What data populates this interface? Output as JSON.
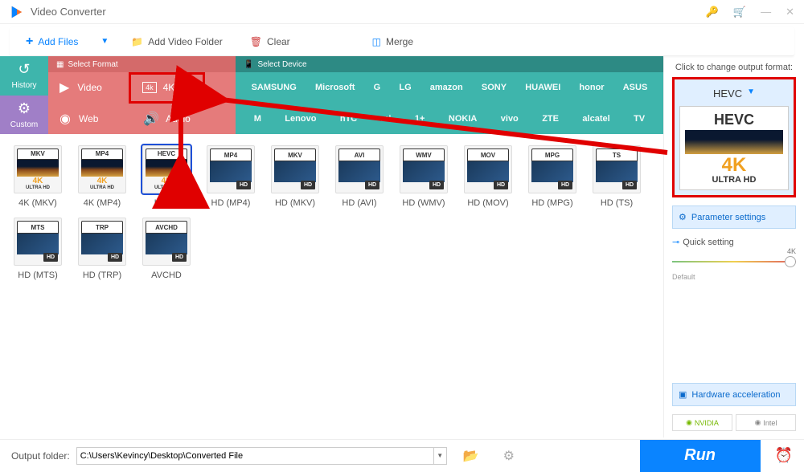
{
  "title": "Video Converter",
  "toolbar": {
    "add_files": "Add Files",
    "add_folder": "Add Video Folder",
    "clear": "Clear",
    "merge": "Merge"
  },
  "side_tabs": {
    "history": "History",
    "custom": "Custom"
  },
  "fmt_tabs": {
    "format": "Select Format",
    "device": "Select Device"
  },
  "fmt_left": {
    "video": "Video",
    "fourk": "4K/HD",
    "web": "Web",
    "audio": "Audio"
  },
  "brands_row1": [
    "SAMSUNG",
    "Microsoft",
    "G",
    "LG",
    "amazon",
    "SONY",
    "HUAWEI",
    "honor",
    "ASUS"
  ],
  "brands_row2": [
    "M",
    "Lenovo",
    "hTC",
    "mi",
    "1+",
    "NOKIA",
    "vivo",
    "ZTE",
    "alcatel",
    "TV"
  ],
  "tiles": [
    {
      "top": "MKV",
      "bot": "ULTRA HD",
      "mode": "u",
      "label": "4K (MKV)"
    },
    {
      "top": "MP4",
      "bot": "ULTRA HD",
      "mode": "u",
      "label": "4K (MP4)"
    },
    {
      "top": "HEVC",
      "bot": "ULTRA HD",
      "mode": "u",
      "label": "HEVC",
      "sel": true
    },
    {
      "top": "MP4",
      "bot": "HD",
      "mode": "hd",
      "label": "HD (MP4)"
    },
    {
      "top": "MKV",
      "bot": "HD",
      "mode": "hd",
      "label": "HD (MKV)"
    },
    {
      "top": "AVI",
      "bot": "HD",
      "mode": "hd",
      "label": "HD (AVI)"
    },
    {
      "top": "WMV",
      "bot": "HD",
      "mode": "hd",
      "label": "HD (WMV)"
    },
    {
      "top": "MOV",
      "bot": "HD",
      "mode": "hd",
      "label": "HD (MOV)"
    },
    {
      "top": "MPG",
      "bot": "HD",
      "mode": "hd",
      "label": "HD (MPG)"
    },
    {
      "top": "TS",
      "bot": "HD",
      "mode": "hd",
      "label": "HD (TS)"
    },
    {
      "top": "MTS",
      "bot": "HD",
      "mode": "hd",
      "label": "HD (MTS)"
    },
    {
      "top": "TRP",
      "bot": "HD",
      "mode": "hd",
      "label": "HD (TRP)"
    },
    {
      "top": "AVCHD",
      "bot": "HD",
      "mode": "hd",
      "label": "AVCHD"
    }
  ],
  "right": {
    "title": "Click to change output format:",
    "selected": "HEVC",
    "hevc": "HEVC",
    "fourk": "4K",
    "uhd": "ULTRA HD",
    "param": "Parameter settings",
    "quick": "Quick setting",
    "quality_max": "4K",
    "default": "Default",
    "hw": "Hardware acceleration",
    "nvidia": "NVIDIA",
    "intel": "Intel"
  },
  "bottom": {
    "label": "Output folder:",
    "path": "C:\\Users\\Kevincy\\Desktop\\Converted File",
    "run": "Run"
  }
}
